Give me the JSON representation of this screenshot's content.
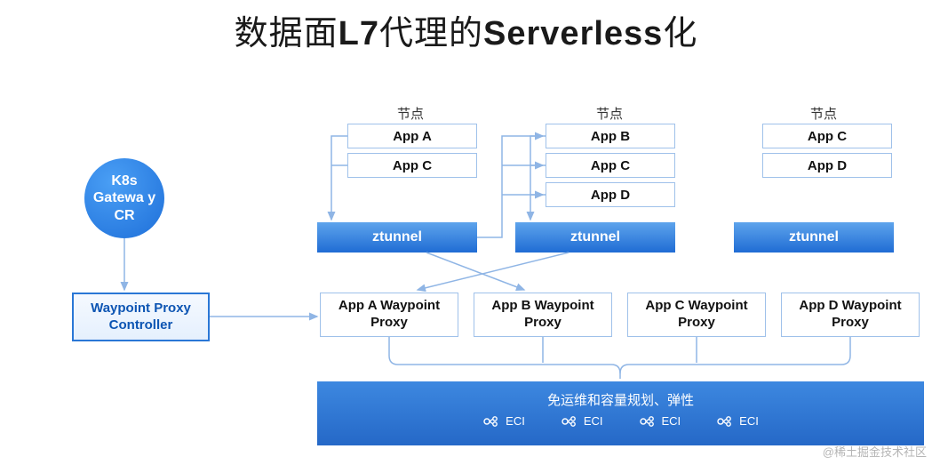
{
  "title_html": "数据面<b>L7</b>代理的<b>Serverless</b>化",
  "circle": "K8s Gatewa y CR",
  "controller": "Waypoint Proxy Controller",
  "node_label": "节点",
  "ztunnel": "ztunnel",
  "nodes": [
    {
      "apps": [
        "App A",
        "App C"
      ]
    },
    {
      "apps": [
        "App B",
        "App C",
        "App D"
      ]
    },
    {
      "apps": [
        "App C",
        "App D"
      ]
    }
  ],
  "waypoints": [
    "App A Waypoint Proxy",
    "App B Waypoint Proxy",
    "App C Waypoint Proxy",
    "App D Waypoint Proxy"
  ],
  "bottom": {
    "line1": "免运维和容量规划、弹性",
    "eci": [
      "ECI",
      "ECI",
      "ECI",
      "ECI"
    ]
  },
  "watermark": "@稀土掘金技术社区"
}
